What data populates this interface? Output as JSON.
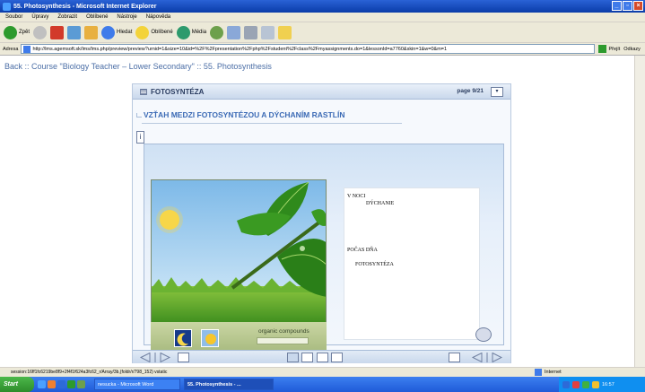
{
  "window": {
    "title": "55. Photosynthesis - Microsoft Internet Explorer",
    "controls": {
      "minimize": "_",
      "maximize": "▫",
      "close": "×"
    }
  },
  "menu": [
    "Soubor",
    "Úpravy",
    "Zobrazit",
    "Oblíbené",
    "Nástroje",
    "Nápověda"
  ],
  "toolbar": {
    "back": "Zpět",
    "search": "Hledat",
    "favorites": "Oblíbené",
    "media": "Média"
  },
  "address": {
    "label": "Adresa",
    "url": "http://lms.agemsoft.sk/lms/lms.php/preview/preview?urnid=1&size=10&id=%2F%2Fpresentation%2Fphp%2Fstudent%2Fclass%2Fmyassignments.do=1&lessonId=a7760&skin=1&w=0&m=1",
    "go": "Přejít",
    "links": "Odkazy"
  },
  "breadcrumb": "Back :: Course \"Biology Teacher – Lower Secondary\" :: 55. Photosynthesis",
  "module": {
    "title": "FOTOSYNTÉZA",
    "page": "page 9/21",
    "dropdown": "▾",
    "subtitle": "VZŤAH MEDZI FOTOSYNTÉZOU A DÝCHANÍM RASTLÍN",
    "info": "i",
    "organic_label": "organic compounds",
    "panel": {
      "night_label": "V NOCI",
      "night_value": "DÝCHANIE",
      "day_label": "POČAS DŇA",
      "day_value": "FOTOSYNTÉZA"
    }
  },
  "status": {
    "text": "session:16ff1fc6219be8f9+2f4f1f624a3fc62_r/Array/3b,(foldr/r/798_152) vstatic",
    "zone": "Internet"
  },
  "taskbar": {
    "start": "Start",
    "tasks": [
      "nesucka - Microsoft Word",
      "55. Photosynthesis - ..."
    ],
    "clock": "16:57"
  },
  "colors": {
    "accent": "#3b6ab5",
    "breadcrumb": "#4b6ea6",
    "taskbar": "#1f5bd8"
  }
}
